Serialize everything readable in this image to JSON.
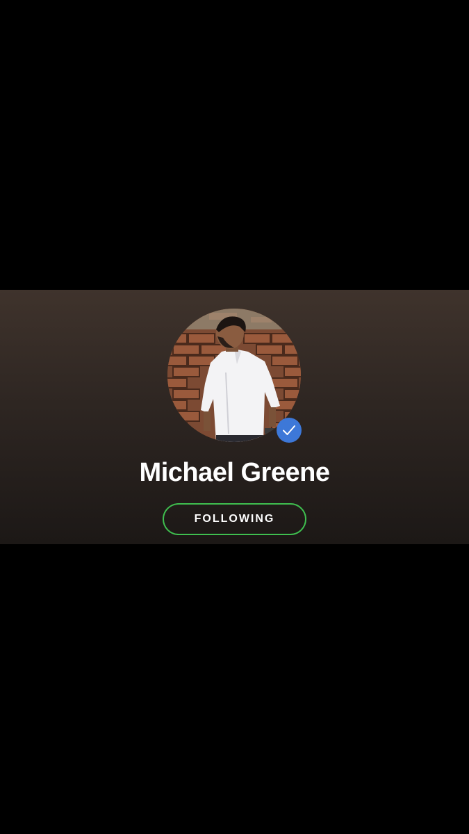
{
  "profile": {
    "name": "Michael Greene",
    "verified": true,
    "follow_button_label": "FOLLOWING"
  },
  "icons": {
    "verified": "checkmark-icon",
    "avatar": "profile-photo"
  },
  "colors": {
    "background": "#000000",
    "header_gradient_top": "#3f332c",
    "header_gradient_bottom": "#1c1816",
    "verified_badge": "#3d78d8",
    "follow_border": "#3fbf4f",
    "text": "#ffffff"
  }
}
